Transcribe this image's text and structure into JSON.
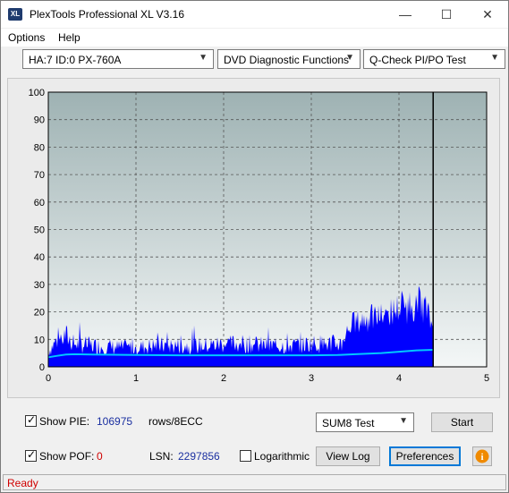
{
  "window": {
    "title": "PlexTools Professional XL V3.16",
    "icon_text": "XL",
    "minimize": "—",
    "maximize": "☐",
    "close": "✕"
  },
  "menu": [
    {
      "label": "Options"
    },
    {
      "label": "Help"
    }
  ],
  "toolbar": {
    "drive": "HA:7 ID:0  PX-760A",
    "function": "DVD Diagnostic Functions",
    "test": "Q-Check PI/PO Test"
  },
  "chart_data": {
    "type": "area",
    "x_ticks": [
      "0",
      "1",
      "2",
      "3",
      "4",
      "5"
    ],
    "y_ticks": [
      "0",
      "5",
      "10",
      "15",
      "20",
      "25",
      "30",
      "35",
      "40",
      "45",
      "50",
      "55",
      "60",
      "65",
      "70",
      "75",
      "80",
      "85",
      "90",
      "95",
      "100"
    ],
    "xlim": [
      0,
      5
    ],
    "ylim": [
      0,
      100
    ],
    "grid": true,
    "scan_end_x": 4.39,
    "colors": {
      "pie_bars": "#0000ff",
      "sum8_line": "#00c8ff",
      "plot_bg_top": "#9eb2b3",
      "plot_bg_bottom": "#f4f7f7",
      "scan_end_marker": "#000000"
    },
    "series": [
      {
        "kind": "PIE bars (envelope)",
        "x": [
          0.0,
          0.1,
          0.2,
          0.3,
          0.5,
          0.8,
          1.0,
          1.2,
          1.5,
          1.8,
          2.0,
          2.2,
          2.5,
          2.8,
          3.0,
          3.2,
          3.35,
          3.45,
          3.6,
          3.8,
          3.9,
          4.0,
          4.1,
          4.2,
          4.3,
          4.39
        ],
        "values": [
          8,
          14,
          16,
          12,
          11,
          10,
          10,
          11,
          11,
          11,
          12,
          12,
          11,
          11,
          12,
          12,
          12,
          20,
          22,
          24,
          25,
          28,
          28,
          30,
          28,
          18
        ]
      },
      {
        "kind": "SUM8 line",
        "x": [
          0.0,
          0.1,
          0.2,
          0.3,
          0.5,
          1.0,
          1.5,
          2.0,
          2.5,
          3.0,
          3.3,
          3.5,
          3.8,
          4.0,
          4.2,
          4.39
        ],
        "values": [
          3.5,
          4.0,
          4.5,
          4.6,
          4.5,
          4.3,
          4.2,
          4.2,
          4.2,
          4.2,
          4.3,
          4.6,
          5.0,
          5.5,
          6.0,
          6.2
        ]
      }
    ]
  },
  "bottom": {
    "show_pie_label": "Show PIE:",
    "pie_value": "106975",
    "pie_unit": "rows/8ECC",
    "show_pof_label": "Show POF:",
    "pof_value": "0",
    "lsn_label": "LSN:",
    "lsn_value": "2297856",
    "logarithmic_label": "Logarithmic",
    "test_select": "SUM8 Test",
    "start": "Start",
    "view_log": "View Log",
    "preferences": "Preferences",
    "info_icon_text": "i"
  },
  "status": {
    "text": "Ready"
  }
}
